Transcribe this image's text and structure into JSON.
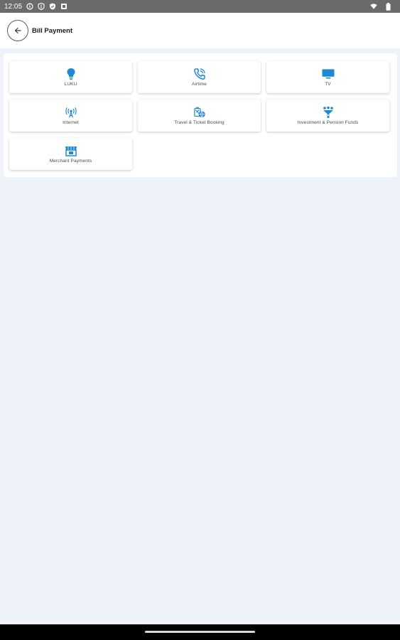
{
  "status_bar": {
    "time": "12:05",
    "left_icons": [
      "info-icon",
      "shield-icon",
      "shield-check-icon",
      "notification-icon"
    ],
    "right_icons": [
      "wifi-icon",
      "battery-icon"
    ]
  },
  "header": {
    "title": "Bill Payment",
    "back_icon": "arrow-left-icon"
  },
  "accent_color": "#1e88d4",
  "tiles": [
    {
      "label": "LUKU",
      "icon": "bulb-icon"
    },
    {
      "label": "Airtime",
      "icon": "phone-call-icon"
    },
    {
      "label": "TV",
      "icon": "tv-icon"
    },
    {
      "label": "Internet",
      "icon": "antenna-icon"
    },
    {
      "label": "Travel & Ticket Booking",
      "icon": "travel-globe-icon"
    },
    {
      "label": "Investment & Pension Funds",
      "icon": "investment-icon"
    },
    {
      "label": "Merchant Payments",
      "icon": "merchant-icon"
    }
  ]
}
